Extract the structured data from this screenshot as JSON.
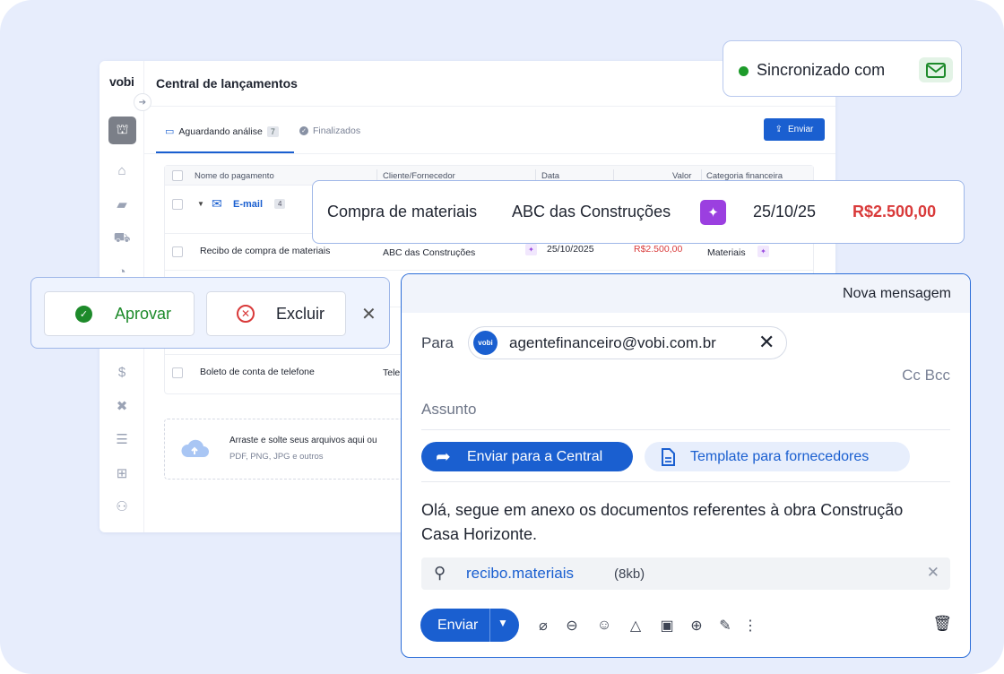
{
  "app": {
    "logo": "vobi",
    "title": "Central de lançamentos",
    "tabs": [
      {
        "label": "Aguardando análise",
        "count": "7"
      },
      {
        "label": "Finalizados"
      }
    ],
    "send_button": "Enviar",
    "table": {
      "headers": [
        "Nome do pagamento",
        "Cliente/Fornecedor",
        "Data",
        "Valor",
        "Categoria financeira"
      ],
      "group": {
        "label": "E-mail",
        "count": "4"
      },
      "rows": [
        {
          "name": "Recibo de compra de materiais",
          "client": "ABC das Construções",
          "date": "25/10/2025",
          "value": "R$2.500,00",
          "category": "Materiais"
        },
        {
          "name": "Boleto de conta de telefone",
          "client": "Tele"
        }
      ]
    },
    "dropzone": {
      "text": "Arraste e solte seus arquivos aqui ou",
      "formats": "PDF, PNG, JPG e outros"
    }
  },
  "sync": {
    "label": "Sincronizado com",
    "status_color": "#1d9b2a"
  },
  "transaction": {
    "description": "Compra de materiais",
    "supplier": "ABC das Construções",
    "date": "25/10/25",
    "value": "R$2.500,00"
  },
  "actions": {
    "approve": "Aprovar",
    "delete": "Excluir"
  },
  "compose": {
    "title": "Nova mensagem",
    "to_label": "Para",
    "recipient_avatar": "vobi",
    "recipient": "agentefinanceiro@vobi.com.br",
    "cc_bcc": "Cc Bcc",
    "subject_placeholder": "Assunto",
    "quick_actions": {
      "central": "Enviar para a Central",
      "template": "Template para fornecedores"
    },
    "body": "Olá, segue em anexo os documentos referentes à obra Construção Casa Horizonte.",
    "attachment": {
      "name": "recibo.materiais",
      "size": "(8kb)"
    },
    "send_label": "Enviar"
  },
  "colors": {
    "accent": "#1a5fd0",
    "value_red": "#d93a3a",
    "approve_green": "#1d8a2a",
    "ai_purple": "#9b3fe0"
  }
}
